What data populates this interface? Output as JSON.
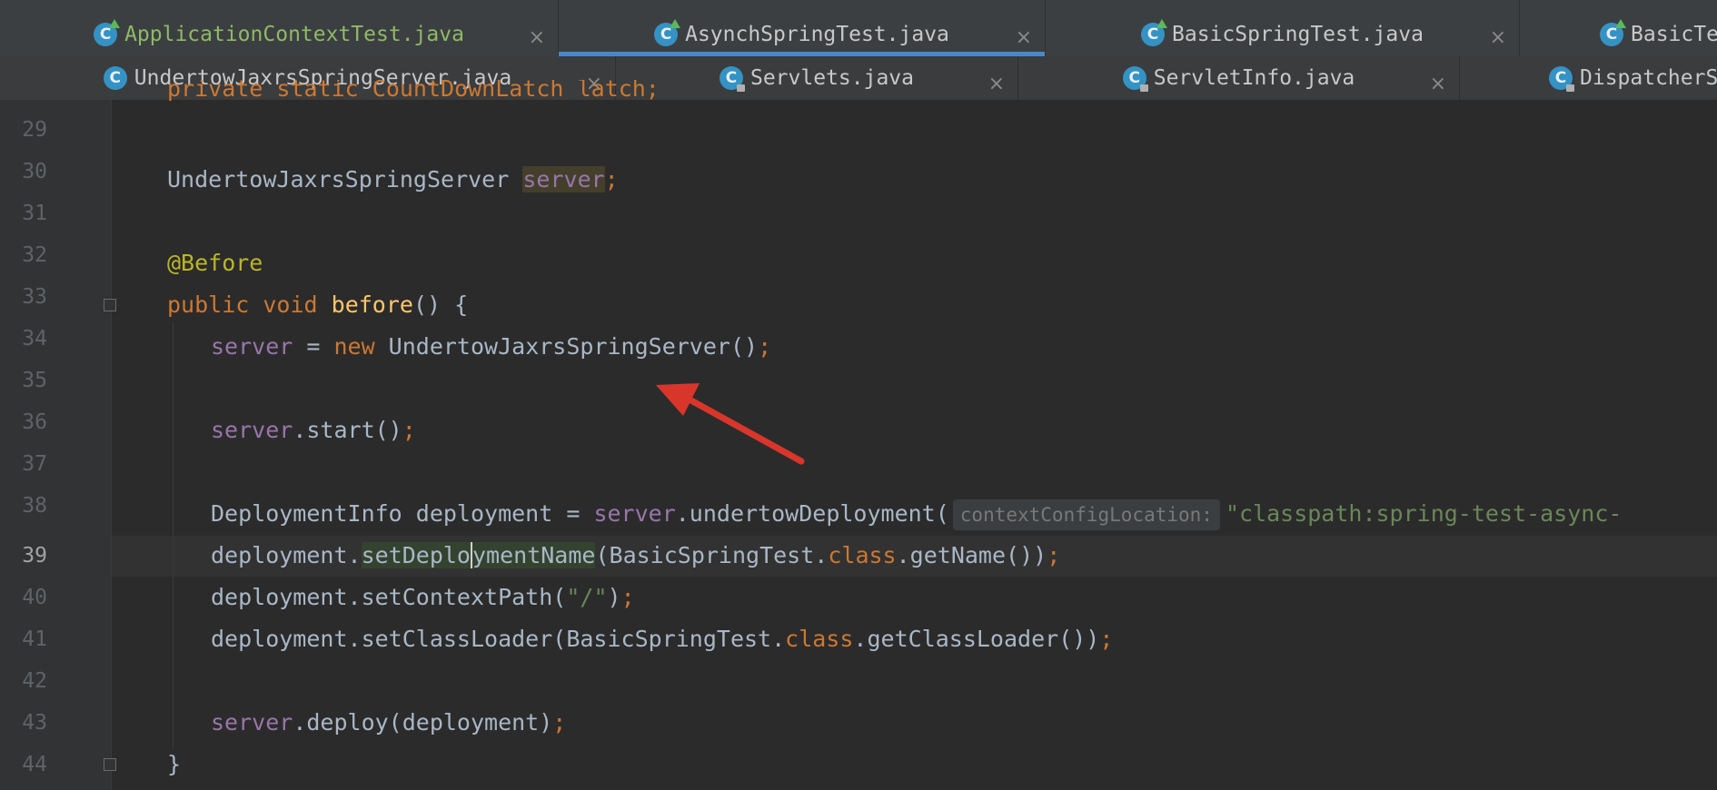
{
  "editor_tabs_row1": [
    {
      "label": "ApplicationContextTest.java",
      "icon": "spring-class-icon",
      "active": false
    },
    {
      "label": "AsynchSpringTest.java",
      "icon": "spring-class-icon",
      "active": true
    },
    {
      "label": "BasicSpringTest.java",
      "icon": "spring-class-icon",
      "active": false
    },
    {
      "label": "BasicTe",
      "icon": "spring-class-icon",
      "active": false
    }
  ],
  "editor_tabs_row2": [
    {
      "label": "UndertowJaxrsSpringServer.java",
      "icon": "class-icon"
    },
    {
      "label": "Servlets.java",
      "icon": "locked-class-icon"
    },
    {
      "label": "ServletInfo.java",
      "icon": "locked-class-icon"
    },
    {
      "label": "DispatcherS",
      "icon": "locked-class-icon"
    }
  ],
  "tab_close_glyph": "×",
  "class_icon_letter": "C",
  "line_numbers": [
    "29",
    "30",
    "31",
    "32",
    "33",
    "34",
    "35",
    "36",
    "37",
    "38",
    "39",
    "40",
    "41",
    "42",
    "43",
    "44"
  ],
  "current_line": "39",
  "code": {
    "l28_partial": "private static CountDownLatch latch;",
    "l30_type": "UndertowJaxrsSpringServer",
    "l30_field": "server",
    "l30_end": ";",
    "l32_annotation": "@Before",
    "l33_kw": "public void",
    "l33_method": "before",
    "l33_rest": "() {",
    "l34_field": "server",
    "l34_eq": " = ",
    "l34_new": "new",
    "l34_ctor": " UndertowJaxrsSpringServer()",
    "l34_semi": ";",
    "l36_field": "server",
    "l36_call": ".start()",
    "l36_semi": ";",
    "l38_decl": "DeploymentInfo deployment = ",
    "l38_field": "server",
    "l38_call": ".undertowDeployment(",
    "l38_hint": "contextConfigLocation:",
    "l38_str": "\"classpath:spring-test-async-",
    "l39_a": "deployment.",
    "l39_m1": "setDeplo",
    "l39_m2": "ymentName",
    "l39_b": "(BasicSpringTest.",
    "l39_class": "class",
    "l39_c": ".getName())",
    "l39_semi": ";",
    "l40_a": "deployment.setContextPath(",
    "l40_str": "\"/\"",
    "l40_b": ")",
    "l40_semi": ";",
    "l41_a": "deployment.setClassLoader(BasicSpringTest.",
    "l41_class": "class",
    "l41_b": ".getClassLoader())",
    "l41_semi": ";",
    "l43_field": "server",
    "l43_call": ".deploy(deployment)",
    "l43_semi": ";",
    "l44_brace": "}"
  },
  "annotation_arrow_color": "#d9362b"
}
